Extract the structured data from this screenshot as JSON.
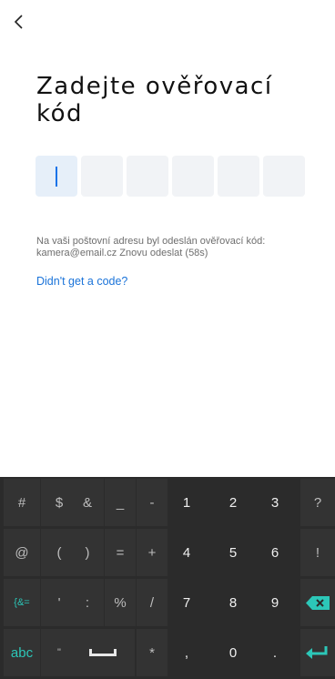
{
  "header": {
    "back_icon": "chevron-left-icon"
  },
  "title": "Zadejte ověřovací kód",
  "code_input": {
    "length": 6,
    "value": ""
  },
  "info": {
    "message": "Na vaši poštovní adresu byl odeslán ověřovací kód: kamera@email.cz Znovu odeslat (58s)",
    "help_link": "Didn't get a code?"
  },
  "colors": {
    "accent": "#1a73e8",
    "keyboard_bg": "#2b2b2b",
    "keyboard_teal": "#2cc7b8"
  },
  "keyboard": {
    "row1": {
      "hash": "#",
      "dollar": "$",
      "amp": "&",
      "underscore": "_",
      "minus": "-",
      "n1": "1",
      "n2": "2",
      "n3": "3",
      "question": "?"
    },
    "row2": {
      "at": "@",
      "lparen": "(",
      "rparen": ")",
      "equals": "=",
      "plus": "+",
      "n4": "4",
      "n5": "5",
      "n6": "6",
      "excl": "!"
    },
    "row3": {
      "more_symbols": "{&=",
      "apostrophe": "'",
      "colon": ":",
      "percent": "%",
      "slash": "/",
      "n7": "7",
      "n8": "8",
      "n9": "9",
      "delete_icon": "backspace-icon"
    },
    "row4": {
      "abc": "abc",
      "quote": "\"",
      "space_icon": "space-bar-icon",
      "asterisk": "*",
      "comma": ",",
      "n0": "0",
      "period": ".",
      "enter_icon": "enter-icon"
    }
  }
}
